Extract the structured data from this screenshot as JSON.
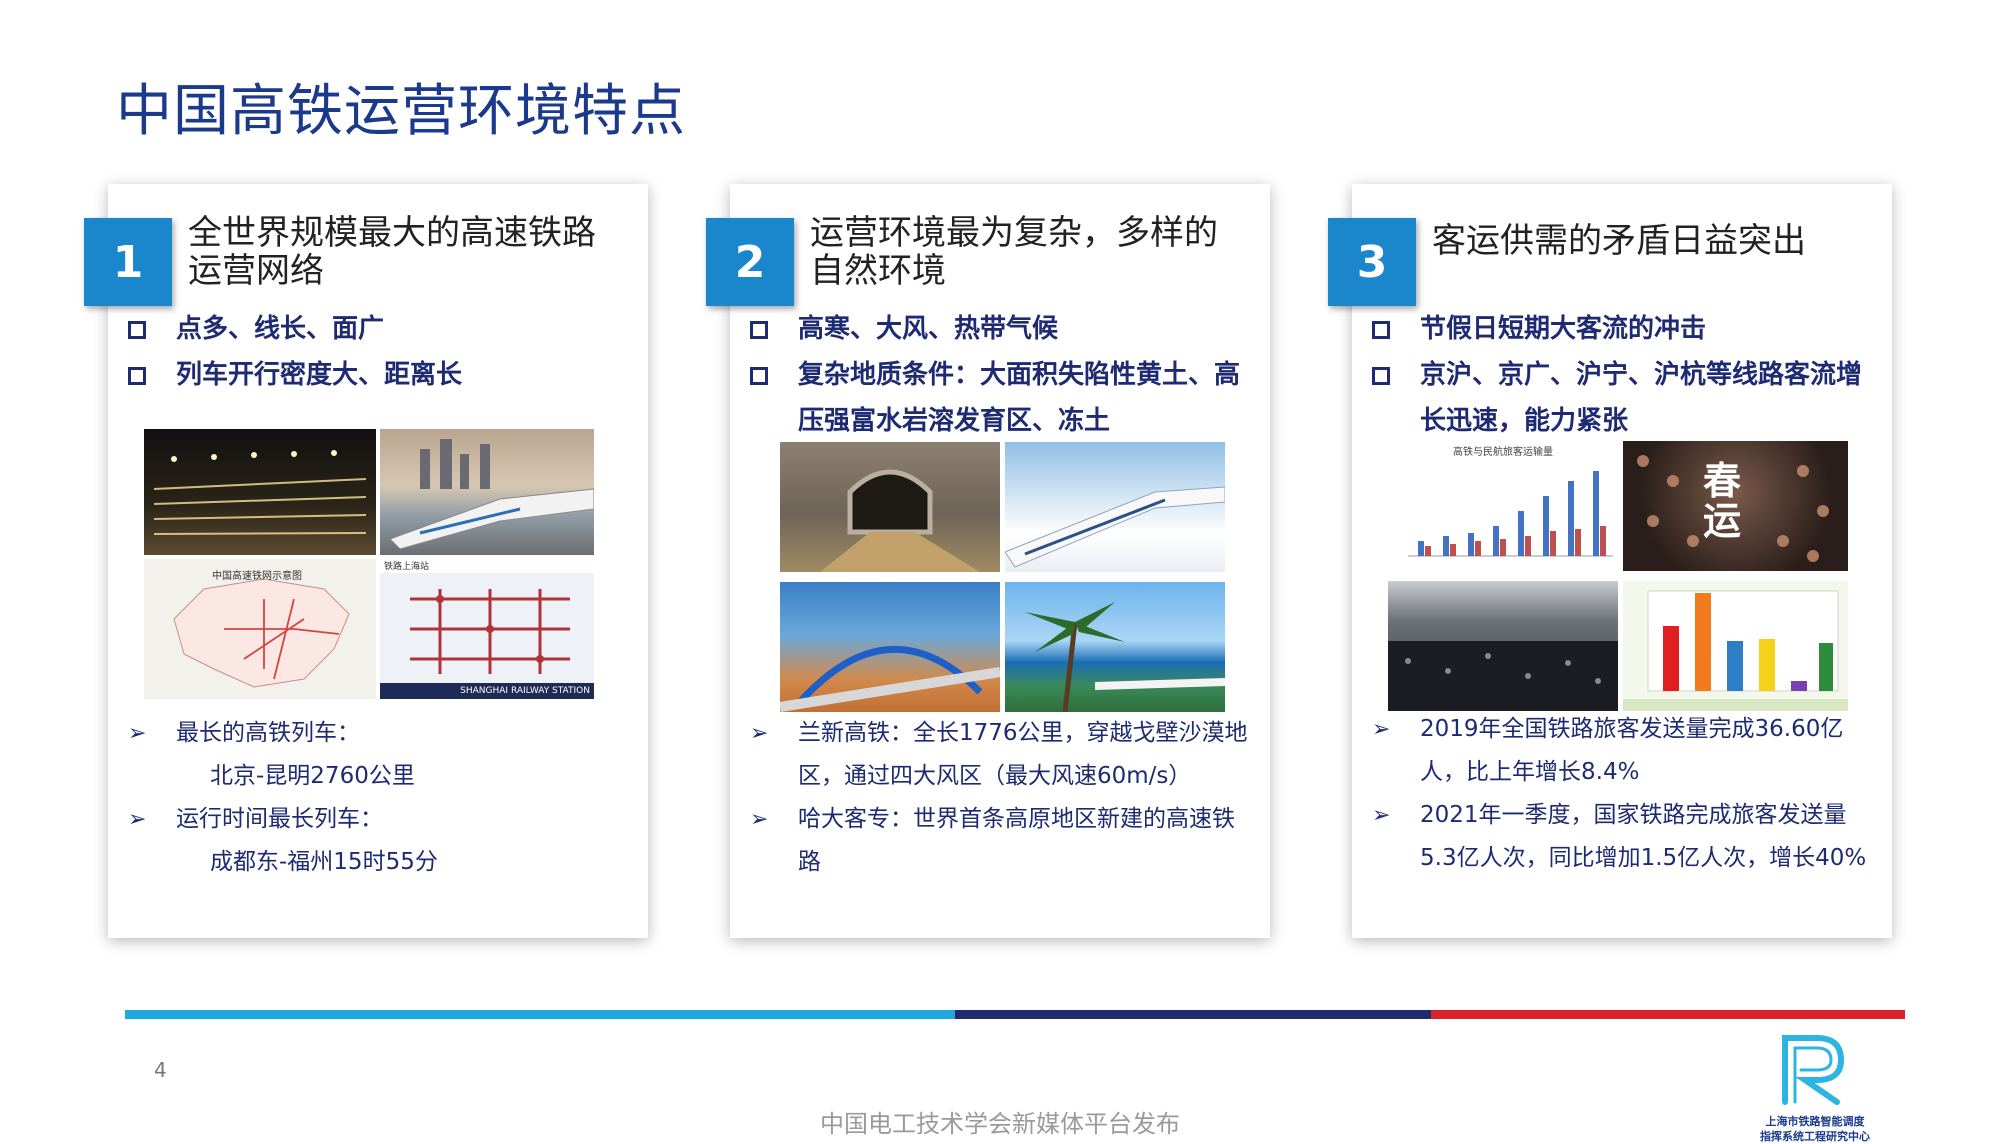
{
  "title": "中国高铁运营环境特点",
  "cards": [
    {
      "num": "1",
      "heading": "全世界规模最大的高速铁路\n运营网络",
      "bullets": [
        "点多、线长、面广",
        "列车开行密度大、距离长"
      ],
      "images": {
        "map_caption": "中国高速铁网示意图",
        "station_title": "铁路上海站",
        "station_caption": "SHANGHAI RAILWAY STATION"
      },
      "notes": [
        {
          "text": "最长的高铁列车：",
          "type": "arrow"
        },
        {
          "text": "北京-昆明2760公里",
          "type": "sub"
        },
        {
          "text": "运行时间最长列车：",
          "type": "arrow"
        },
        {
          "text": "成都东-福州15时55分",
          "type": "sub"
        }
      ]
    },
    {
      "num": "2",
      "heading": "运营环境最为复杂，多样的\n自然环境",
      "bullets": [
        "高寒、大风、热带气候",
        "复杂地质条件：大面积失陷性黄土、高压强富水岩溶发育区、冻土"
      ],
      "notes": [
        {
          "text": "兰新高铁：全长1776公里，穿越戈壁沙漠地区，通过四大风区（最大风速60m/s）",
          "type": "arrow"
        },
        {
          "text": "哈大客专：世界首条高原地区新建的高速铁路",
          "type": "arrow"
        }
      ]
    },
    {
      "num": "3",
      "heading": "客运供需的矛盾日益突出",
      "bullets": [
        "节假日短期大客流的冲击",
        "京沪、京广、沪宁、沪杭等线路客流增长迅速，能力紧张"
      ],
      "images": {
        "chart_title": "高铁与民航旅客运输量",
        "chunyun_text": "春运"
      },
      "notes": [
        {
          "text": "2019年全国铁路旅客发送量完成36.60亿人，比上年增长8.4%",
          "type": "arrow"
        },
        {
          "text": "2021年一季度，国家铁路完成旅客发送量5.3亿人次，同比增加1.5亿人次，增长40%",
          "type": "arrow"
        }
      ]
    }
  ],
  "page_number": "4",
  "footer": "中国电工技术学会新媒体平台发布",
  "logo_text": [
    "上海市铁路智能调度",
    "指挥系统工程研究中心"
  ],
  "colors": {
    "accent": "#1a86cc",
    "title": "#1b3a8c",
    "rule_cyan": "#1fa8e0",
    "rule_navy": "#1f2b6e",
    "rule_red": "#d9232d"
  }
}
